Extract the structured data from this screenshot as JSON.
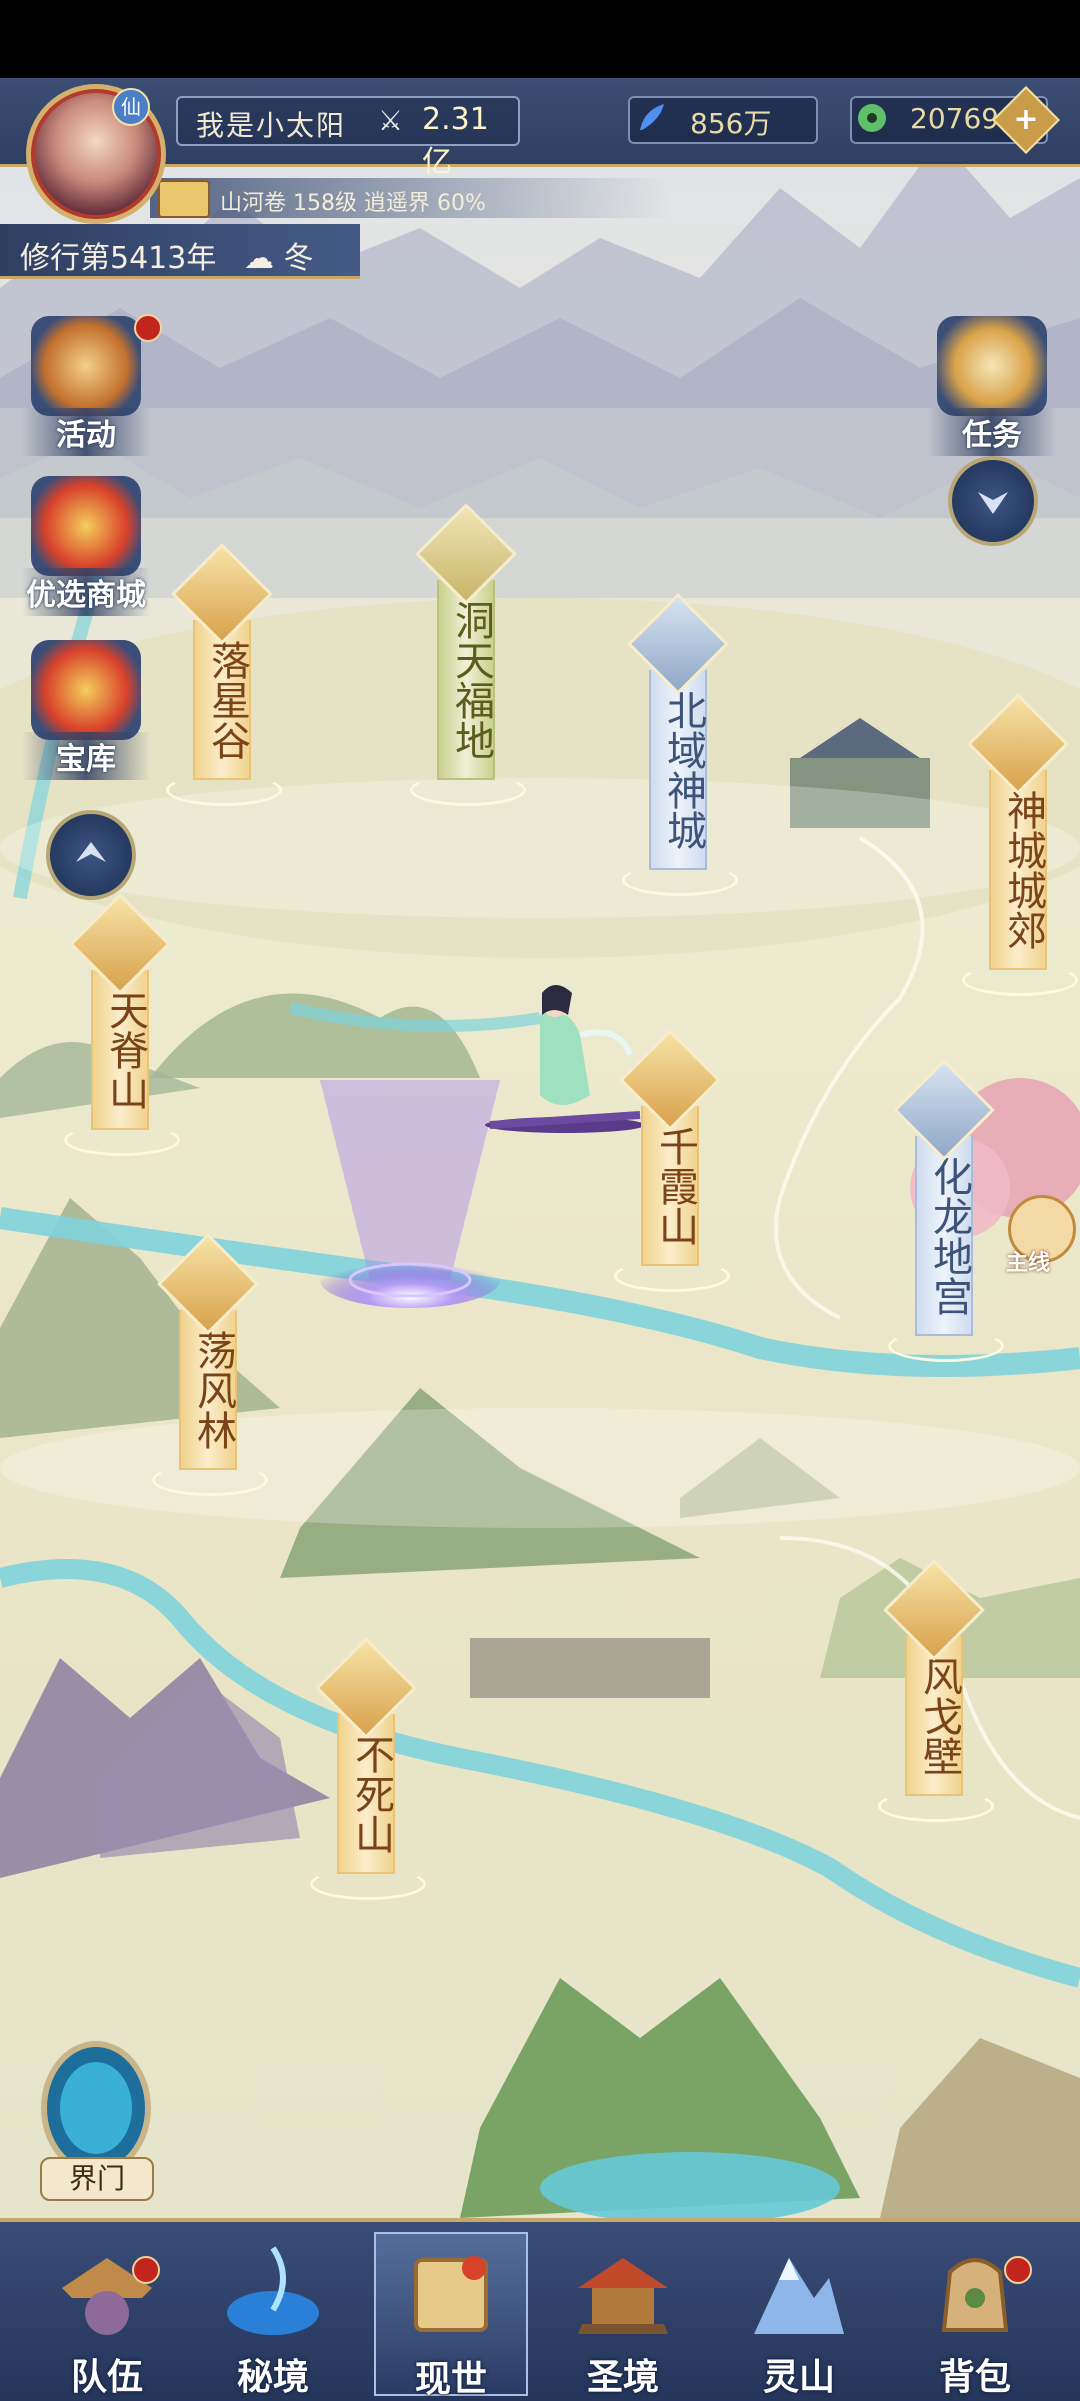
{
  "player": {
    "avatar_badge": "仙",
    "name": "我是小太阳",
    "power": "2.31亿",
    "realm_info": "山河卷 158级 逍遥界 60%"
  },
  "resources": [
    {
      "icon": "feather-icon",
      "value": "856万",
      "color": "#4f8ff0"
    },
    {
      "icon": "jade-coin-icon",
      "value": "20769",
      "color": "#5fbf6a"
    }
  ],
  "status": {
    "year": "修行第5413年",
    "season": "冬"
  },
  "side_buttons": {
    "activity": "活动",
    "shop": "优选商城",
    "treasury": "宝库",
    "quest": "任务"
  },
  "locations": {
    "luoxinggu": "落星谷",
    "dongtianfudi": "洞天福地",
    "beiyushencheng": "北域神城",
    "shenchengchengjiao": "神城城郊",
    "tianjishan": "天脊山",
    "qianxiashan": "千霞山",
    "hualongdigong": "化龙地宫",
    "dangfenglin": "荡风林",
    "busishan": "不死山",
    "fenggebi": "风戈壁"
  },
  "mainline_label": "主线",
  "gate_label": "界门",
  "bottom_nav": [
    {
      "label": "队伍",
      "icon": "team-icon",
      "has_dot": true
    },
    {
      "label": "秘境",
      "icon": "secret-realm-icon",
      "has_dot": false
    },
    {
      "label": "现世",
      "icon": "world-map-icon",
      "has_dot": false
    },
    {
      "label": "圣境",
      "icon": "holy-realm-icon",
      "has_dot": false
    },
    {
      "label": "灵山",
      "icon": "spirit-mountain-icon",
      "has_dot": false
    },
    {
      "label": "背包",
      "icon": "backpack-icon",
      "has_dot": true
    }
  ],
  "active_tab": "现世",
  "colors": {
    "hud": "#2f3f62",
    "gold": "#c9a766",
    "river": "#7fd3dc"
  }
}
